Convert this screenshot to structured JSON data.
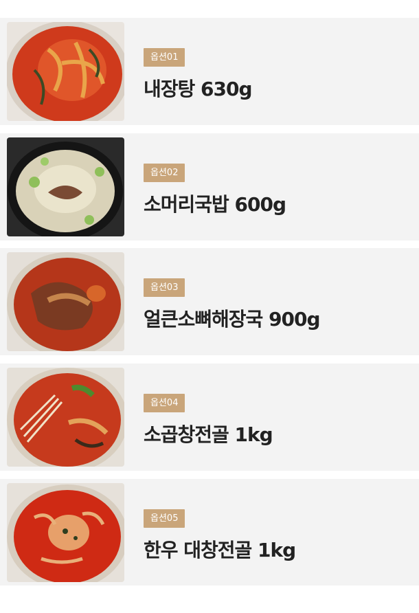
{
  "options": [
    {
      "badge": "옵션01",
      "name": "내장탕 630g",
      "image_icon": "spicy-beef-tripe-soup-image"
    },
    {
      "badge": "옵션02",
      "name": "소머리국밥 600g",
      "image_icon": "beef-head-soup-rice-image"
    },
    {
      "badge": "옵션03",
      "name": "얼큰소뼈해장국 900g",
      "image_icon": "spicy-beef-bone-hangover-soup-image"
    },
    {
      "badge": "옵션04",
      "name": "소곱창전골 1kg",
      "image_icon": "beef-intestine-hotpot-image"
    },
    {
      "badge": "옵션05",
      "name": "한우 대창전골 1kg",
      "image_icon": "korean-beef-large-intestine-hotpot-image"
    }
  ],
  "colors": {
    "badge_bg": "#c9a57a",
    "card_bg": "#f3f3f3",
    "text": "#222222"
  }
}
